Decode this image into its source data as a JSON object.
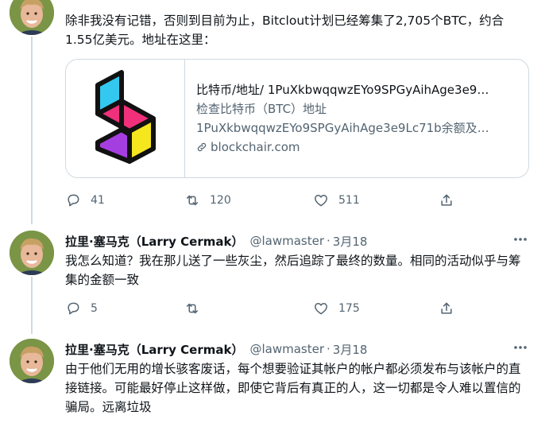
{
  "tweets": [
    {
      "name": "",
      "handle": "",
      "date": "",
      "text": "除非我没有记错，否则到目前为止，Bitclout计划已经筹集了2,705个BTC，约合1.55亿美元。地址在这里：",
      "card": {
        "title": "比特币/地址/ 1PuXkbwqqwzEYo9SPGyAihAge3e9…",
        "desc_line1": "检查比特币（BTC）地址",
        "desc_line2": "1PuXkbwqqwzEYo9SPGyAihAge3e9Lc71b余额及…",
        "domain": "blockchair.com"
      },
      "replies": "41",
      "retweets": "120",
      "likes": "511"
    },
    {
      "name": "拉里·塞马克（Larry Cermak）",
      "handle": "@lawmaster",
      "date": "3月18",
      "text": "我怎么知道？我在那儿送了一些灰尘，然后追踪了最终的数量。相同的活动似乎与筹集的金额一致",
      "replies": "5",
      "retweets": "",
      "likes": "175"
    },
    {
      "name": "拉里·塞马克（Larry Cermak）",
      "handle": "@lawmaster",
      "date": "3月18",
      "text": "由于他们无用的增长骇客废话，每个想要验证其帐户的帐户都必须发布与该帐户的直接链接。可能最好停止这样做，即使它背后有真正的人，这一切都是令人难以置信的骗局。远离垃圾"
    }
  ],
  "icons": {
    "reply": "reply-icon",
    "retweet": "retweet-icon",
    "like": "heart-icon",
    "share": "share-icon",
    "more": "more-icon",
    "link": "link-icon"
  },
  "colors": {
    "text": "#0f1419",
    "secondary": "#536471",
    "border": "#cfd9de",
    "link_card_logo_cyan": "#33c8f0",
    "link_card_logo_pink": "#f0307a",
    "link_card_logo_yellow": "#f5e61e",
    "link_card_logo_purple": "#a53ee0"
  }
}
